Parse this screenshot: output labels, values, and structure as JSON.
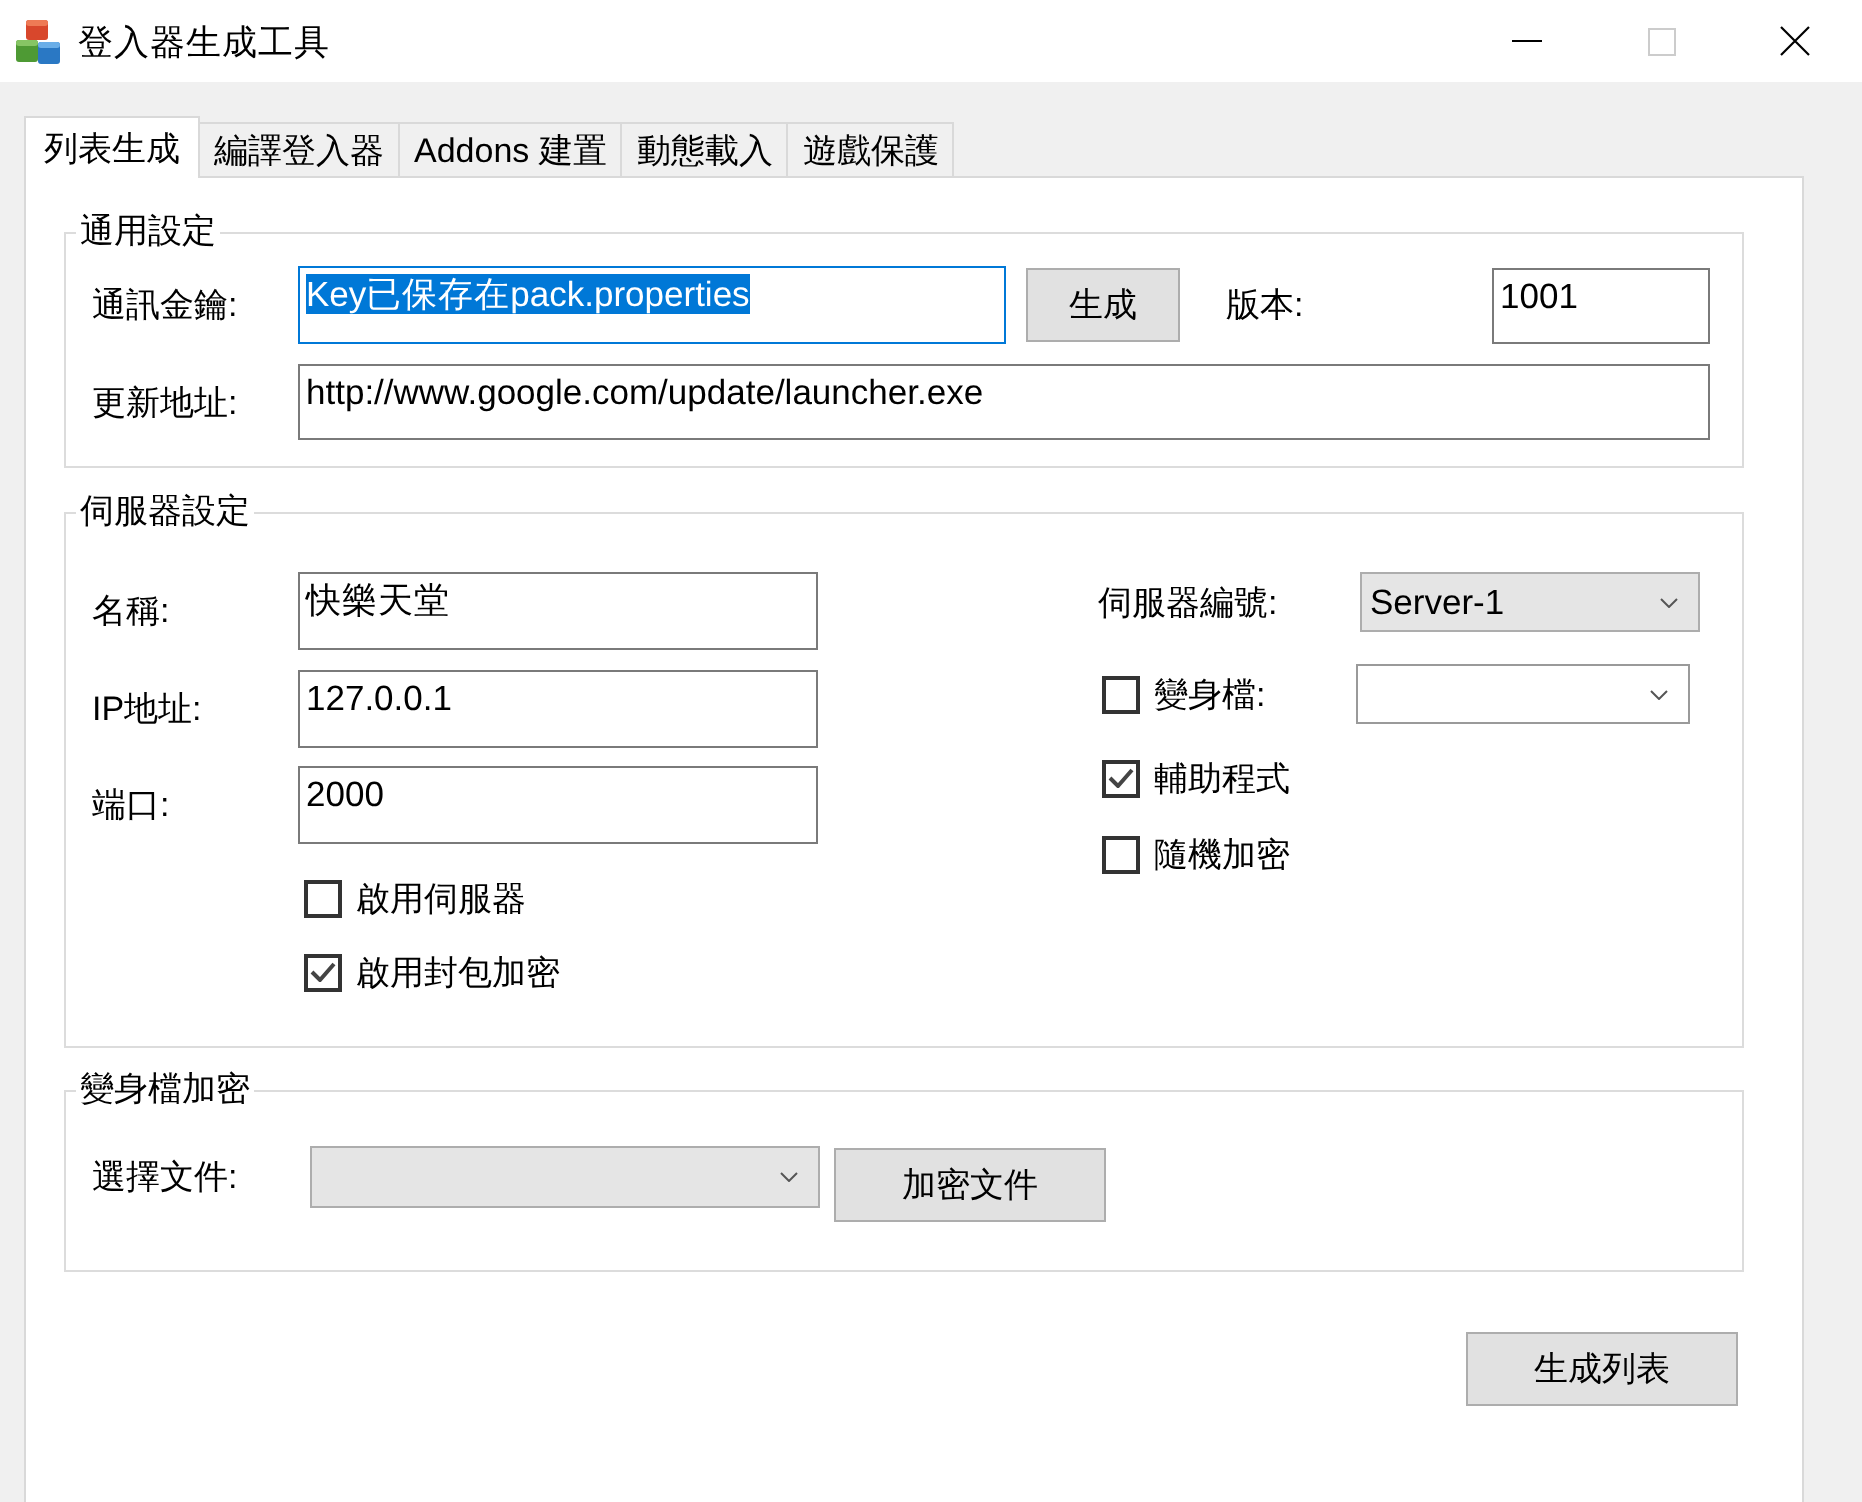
{
  "window": {
    "title": "登入器生成工具",
    "maximize_disabled": true
  },
  "tabs": [
    {
      "label": "列表生成",
      "selected": true
    },
    {
      "label": "編譯登入器",
      "selected": false
    },
    {
      "label": "Addons 建置",
      "selected": false
    },
    {
      "label": "動態載入",
      "selected": false
    },
    {
      "label": "遊戲保護",
      "selected": false
    }
  ],
  "general": {
    "title": "通用設定",
    "key": {
      "label": "通訊金鑰:",
      "value": "Key已保存在pack.properties",
      "focused": true
    },
    "generate_button": "生成",
    "version": {
      "label": "版本:",
      "value": "1001"
    },
    "update_url": {
      "label": "更新地址:",
      "value": "http://www.google.com/update/launcher.exe"
    }
  },
  "server": {
    "title": "伺服器設定",
    "fields": [
      {
        "label": "名稱:",
        "value": "快樂天堂"
      },
      {
        "label": "IP地址:",
        "value": "127.0.0.1"
      },
      {
        "label": "端口:",
        "value": "2000"
      }
    ],
    "checkboxes": [
      {
        "label": "啟用伺服器",
        "checked": false
      },
      {
        "label": "啟用封包加密",
        "checked": true
      }
    ],
    "server_number": {
      "label": "伺服器編號:",
      "value": "Server-1",
      "editable": false
    },
    "options": [
      {
        "kind": "checkbox_dropdown",
        "label": "變身檔:",
        "checked": false,
        "editable": true
      },
      {
        "kind": "checkbox",
        "label": "輔助程式",
        "checked": true
      },
      {
        "kind": "checkbox",
        "label": "隨機加密",
        "checked": false
      }
    ]
  },
  "morph_encryption": {
    "title": "變身檔加密",
    "file": {
      "label": "選擇文件:",
      "editable": false
    },
    "encrypt_button": "加密文件"
  },
  "generate_list_button": "生成列表"
}
